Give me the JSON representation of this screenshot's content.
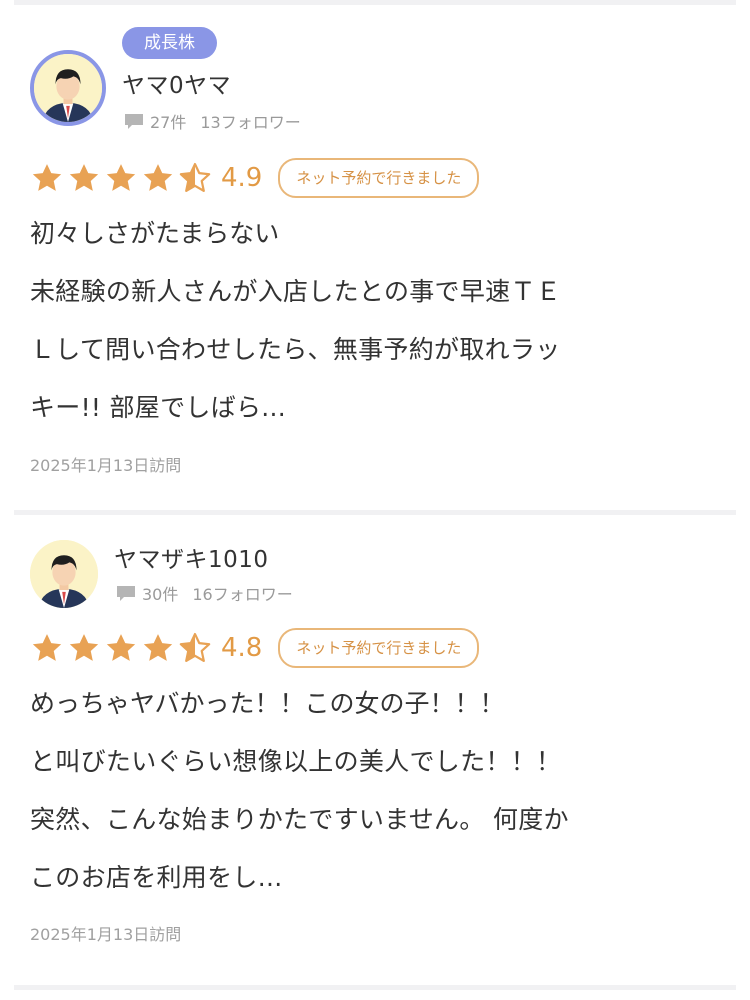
{
  "reviews": [
    {
      "rank_badge": "成長株",
      "username": "ヤマ0ヤマ",
      "review_count": "27件",
      "followers": "13フォロワー",
      "rating": 4.9,
      "rating_text": "4.9",
      "visit_type": "ネット予約で行きました",
      "title": "初々しさがたまらない",
      "body_lines": [
        "未経験の新人さんが入店したとの事で早速ＴＥ",
        "Ｌして問い合わせしたら、無事予約が取れラッ",
        "キー!! 部屋でしばら..."
      ],
      "visit_date": "2025年1月13日訪問"
    },
    {
      "username": "ヤマザキ1010",
      "review_count": "30件",
      "followers": "16フォロワー",
      "rating": 4.8,
      "rating_text": "4.8",
      "visit_type": "ネット予約で行きました",
      "title": "めっちゃヤバかった！！この女の子！！！",
      "body_lines": [
        "と叫びたいぐらい想像以上の美人でした！！！",
        "突然、こんな始まりかたですいません。 何度か",
        "このお店を利用をし..."
      ],
      "visit_date": "2025年1月13日訪問"
    }
  ],
  "colors": {
    "star": "#e8a254",
    "accent": "#8a96e6",
    "visit_badge": "#d69246"
  }
}
